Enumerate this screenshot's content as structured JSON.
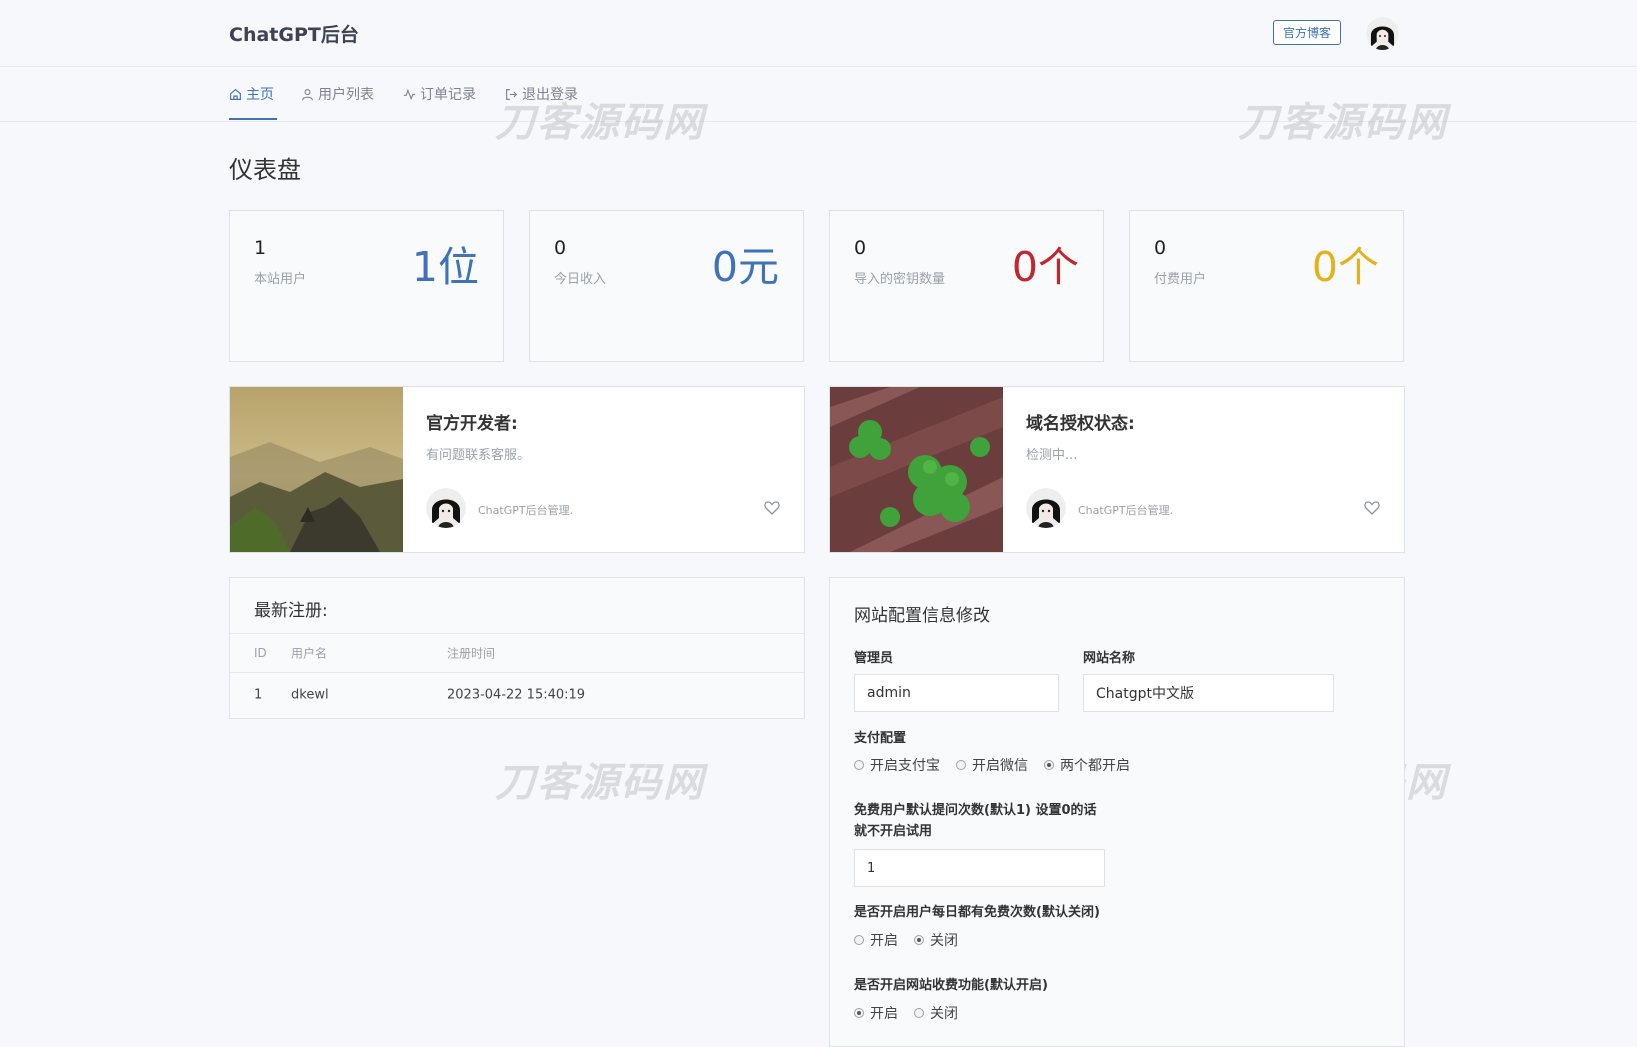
{
  "header": {
    "brand": "ChatGPT后台",
    "blog_button": "官方博客"
  },
  "nav": [
    {
      "label": "主页",
      "icon": "home-icon",
      "active": true
    },
    {
      "label": "用户列表",
      "icon": "user-icon"
    },
    {
      "label": "订单记录",
      "icon": "activity-icon"
    },
    {
      "label": "退出登录",
      "icon": "logout-icon"
    }
  ],
  "page_title": "仪表盘",
  "stats": [
    {
      "number": "1",
      "label": "本站用户",
      "big": "1位",
      "color": "#3f72b8"
    },
    {
      "number": "0",
      "label": "今日收入",
      "big": "0元",
      "color": "#3f72b8"
    },
    {
      "number": "0",
      "label": "导入的密钥数量",
      "big": "0个",
      "color": "#c0282d"
    },
    {
      "number": "0",
      "label": "付费用户",
      "big": "0个",
      "color": "#e2b21c"
    }
  ],
  "promos": [
    {
      "title": "官方开发者:",
      "subtitle": "有问题联系客服。",
      "author": "ChatGPT后台管理."
    },
    {
      "title": "域名授权状态:",
      "subtitle": "检测中...",
      "author": "ChatGPT后台管理."
    }
  ],
  "registrations": {
    "title": "最新注册:",
    "columns": [
      "ID",
      "用户名",
      "注册时间"
    ],
    "rows": [
      [
        "1",
        "dkewl",
        "2023-04-22 15:40:19"
      ]
    ]
  },
  "config": {
    "title": "网站配置信息修改",
    "admin_label": "管理员",
    "admin_value": "admin",
    "site_name_label": "网站名称",
    "site_name_value": "Chatgpt中文版",
    "payment_label": "支付配置",
    "payment_options": [
      "开启支付宝",
      "开启微信",
      "两个都开启"
    ],
    "payment_selected": 2,
    "free_label_1": "免费用户默认提问次数(默认1) 设置0的话",
    "free_label_2": "就不开启试用",
    "free_value": "1",
    "daily_label": "是否开启用户每日都有免费次数(默认关闭)",
    "daily_options": [
      "开启",
      "关闭"
    ],
    "daily_selected": 1,
    "charge_label": "是否开启网站收费功能(默认开启)",
    "charge_options": [
      "开启",
      "关闭"
    ],
    "charge_selected": 0
  },
  "watermark": "刀客源码网"
}
